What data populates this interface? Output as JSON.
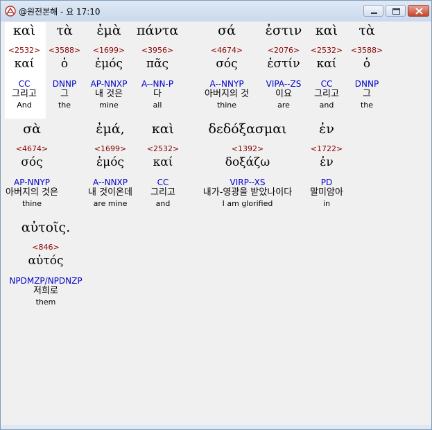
{
  "window": {
    "title": "@원전본해 - 요 17:10",
    "icon": "app-book-icon",
    "buttons": [
      "minimize-icon",
      "maximize-icon",
      "close-icon"
    ],
    "colors": {
      "strong": "#8b0000",
      "parse": "#0000cc",
      "text": "#000000",
      "close": "#c5452d"
    }
  },
  "words": [
    {
      "greek": "καὶ",
      "strong": "<2532>",
      "lexeme": "καί",
      "parse": "CC",
      "korean": "그리고",
      "english": "And"
    },
    {
      "greek": "τὰ",
      "strong": "<3588>",
      "lexeme": "ὁ",
      "parse": "DNNP",
      "korean": "그",
      "english": "the"
    },
    {
      "greek": "ἐμὰ",
      "strong": "<1699>",
      "lexeme": "ἐμός",
      "parse": "AP-NNXP",
      "korean": "내 것은",
      "english": "mine"
    },
    {
      "greek": "πάντα",
      "strong": "<3956>",
      "lexeme": "πᾶς",
      "parse": "A--NN-P",
      "korean": "다",
      "english": "all"
    },
    {
      "greek": "σά",
      "strong": "<4674>",
      "lexeme": "σός",
      "parse": "A--NNYP",
      "korean": "아버지의 것",
      "english": "thine"
    },
    {
      "greek": "ἐστιν",
      "strong": "<2076>",
      "lexeme": "ἐστίν",
      "parse": "VIPA--ZS",
      "korean": "이요",
      "english": "are"
    },
    {
      "greek": "καὶ",
      "strong": "<2532>",
      "lexeme": "καί",
      "parse": "CC",
      "korean": "그리고",
      "english": "and"
    },
    {
      "greek": "τὰ",
      "strong": "<3588>",
      "lexeme": "ὁ",
      "parse": "DNNP",
      "korean": "그",
      "english": "the"
    },
    {
      "greek": "σὰ",
      "strong": "<4674>",
      "lexeme": "σός",
      "parse": "AP-NNYP",
      "korean": "아버지의 것은",
      "english": "thine"
    },
    {
      "greek": "ἐμά,",
      "strong": "<1699>",
      "lexeme": "ἐμός",
      "parse": "A--NNXP",
      "korean": "내 것이온데",
      "english": "are mine"
    },
    {
      "greek": "καὶ",
      "strong": "<2532>",
      "lexeme": "καί",
      "parse": "CC",
      "korean": "그리고",
      "english": "and"
    },
    {
      "greek": "δεδόξασμαι",
      "strong": "<1392>",
      "lexeme": "δοξάζω",
      "parse": "VIRP--XS",
      "korean": "내가-영광을 받았나이다",
      "english": "I am glorified"
    },
    {
      "greek": "ἐν",
      "strong": "<1722>",
      "lexeme": "ἐν",
      "parse": "PD",
      "korean": "말미암아",
      "english": "in"
    },
    {
      "greek": "αὐτοῖς.",
      "strong": "<846>",
      "lexeme": "αὐτός",
      "parse": "NPDMZP/NPDNZP",
      "korean": "저희로",
      "english": "them"
    }
  ]
}
